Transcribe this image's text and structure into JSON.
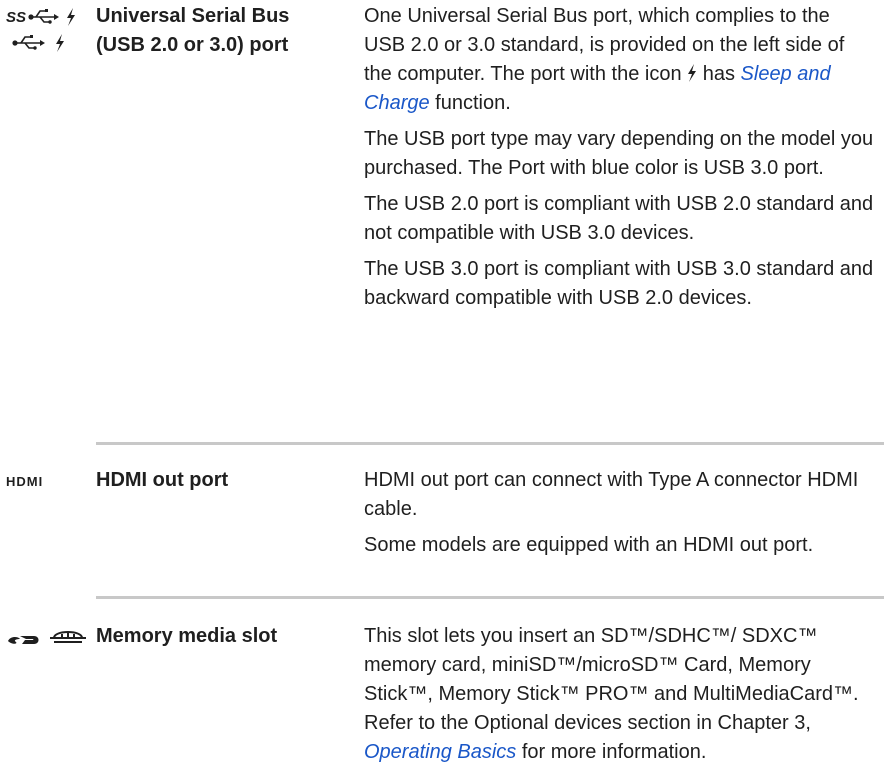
{
  "rows": [
    {
      "term": [
        "Universal Serial Bus",
        "(USB 2.0 or 3.0) port"
      ],
      "icons": [
        "usb-3-superspeed-charge-icon",
        "usb-2-charge-icon"
      ],
      "desc": {
        "p1_pre": "One Universal Serial Bus port, which complies to the USB 2.0 or 3.0 standard, is provided on the left side of the computer. The port with the icon",
        "p1_mid": "has",
        "p1_link": "Sleep and Charge",
        "p1_post": "function.",
        "p2": "The USB port type may vary depending on the model you purchased. The Port with blue color is USB 3.0 port.",
        "p3": "The USB 2.0 port is compliant with USB 2.0 standard and not compatible with USB 3.0 devices.",
        "p4": "The USB 3.0 port is compliant with USB 3.0 standard and backward compatible with USB 2.0 devices."
      }
    },
    {
      "term": "HDMI out port",
      "icon_text": "HDMI",
      "desc": {
        "p1": "HDMI out port can connect with Type A connector HDMI cable.",
        "p2": "Some models are equipped with an HDMI out port."
      }
    },
    {
      "term": "Memory media slot",
      "icons": [
        "sd-card-logo-icon",
        "memory-stick-logo-icon"
      ],
      "desc": {
        "p1_pre": "This slot lets you insert an SD™/SDHC™/ SDXC™ memory card, miniSD™/microSD™ Card, Memory Stick™, Memory Stick™ PRO™ and MultiMediaCard™. Refer to the Optional devices section in Chapter 3,",
        "p1_link": "Operating Basics",
        "p1_post": "for more information."
      }
    }
  ],
  "colors": {
    "text": "#1f1f1f",
    "link": "#1a57c8",
    "separator": "#c8c8c8"
  }
}
